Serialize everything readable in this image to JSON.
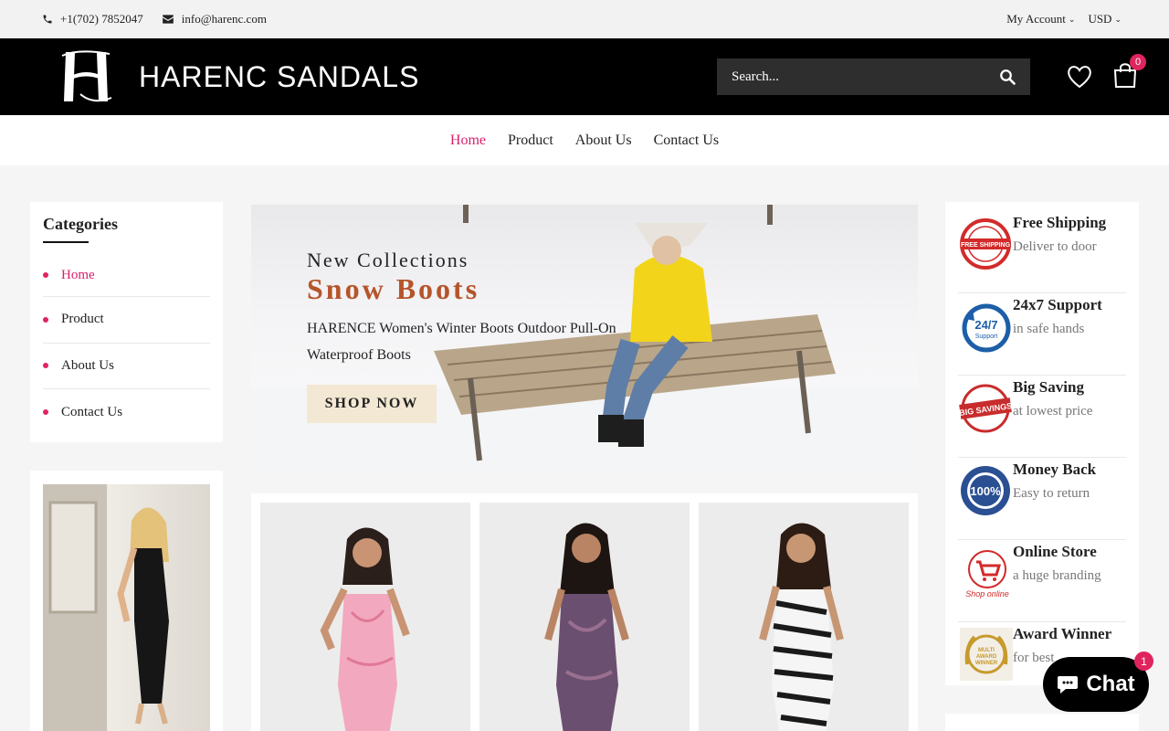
{
  "topbar": {
    "phone": "+1(702) 7852047",
    "email": "info@harenc.com",
    "account": "My Account",
    "currency": "USD"
  },
  "header": {
    "logo_text": "HARENC SANDALS",
    "search_placeholder": "Search...",
    "cart_count": "0"
  },
  "nav": {
    "items": [
      {
        "label": "Home",
        "active": true
      },
      {
        "label": "Product"
      },
      {
        "label": "About Us"
      },
      {
        "label": "Contact Us"
      }
    ]
  },
  "categories": {
    "title": "Categories",
    "items": [
      {
        "label": "Home"
      },
      {
        "label": "Product"
      },
      {
        "label": "About Us"
      },
      {
        "label": "Contact Us"
      }
    ]
  },
  "banner": {
    "subtitle": "New Collections",
    "title": "Snow Boots",
    "description": "HARENCE Women's Winter Boots Outdoor Pull-On Waterproof Boots",
    "button": "SHOP NOW"
  },
  "features": [
    {
      "title": "Free Shipping",
      "subtitle": "Deliver to door",
      "icon": "free-shipping-icon"
    },
    {
      "title": "24x7 Support",
      "subtitle": "in safe hands",
      "icon": "support-icon"
    },
    {
      "title": "Big Saving",
      "subtitle": "at lowest price",
      "icon": "big-savings-icon"
    },
    {
      "title": "Money Back",
      "subtitle": "Easy to return",
      "icon": "guarantee-icon"
    },
    {
      "title": "Online Store",
      "subtitle": "a huge branding",
      "icon": "shop-online-icon"
    },
    {
      "title": "Award Winner",
      "subtitle": "for best",
      "icon": "award-icon"
    }
  ],
  "chat": {
    "label": "Chat",
    "badge": "1"
  },
  "colors": {
    "accent": "#d6206d",
    "header_bg": "#000000",
    "banner_title": "#b5552a"
  }
}
